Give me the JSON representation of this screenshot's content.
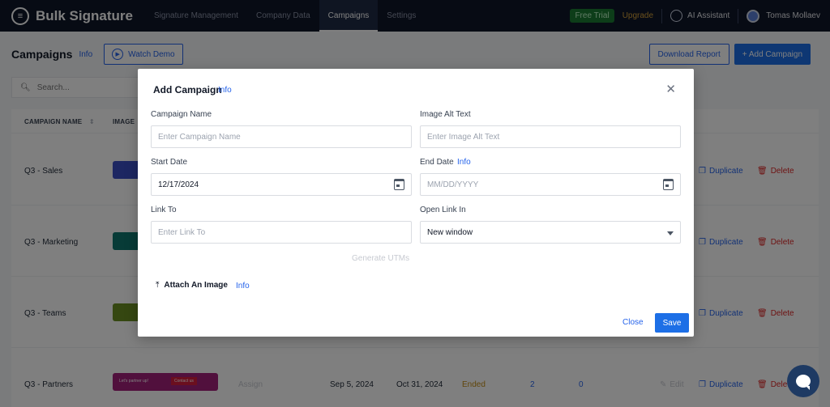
{
  "app": {
    "name": "Bulk Signature"
  },
  "nav": {
    "items": [
      {
        "label": "Signature Management"
      },
      {
        "label": "Company Data"
      },
      {
        "label": "Campaigns"
      },
      {
        "label": "Settings"
      }
    ],
    "active": "Campaigns",
    "free_trial": "Free Trial",
    "upgrade": "Upgrade",
    "ai_assistant": "AI Assistant",
    "user_name": "Tomas Mollaev"
  },
  "page": {
    "title": "Campaigns",
    "info": "Info",
    "watch_demo": "Watch Demo",
    "download_report": "Download Report",
    "add_campaign": "+ Add Campaign"
  },
  "search": {
    "placeholder": "Search..."
  },
  "table": {
    "headers": {
      "name": "CAMPAIGN NAME",
      "image": "IMAGE"
    },
    "rows": [
      {
        "name": "Q3 - Sales",
        "banner_color": "#3b4fc4",
        "duplicate": "Duplicate",
        "delete": "Delete"
      },
      {
        "name": "Q3 - Marketing",
        "banner_color": "#0f766e",
        "duplicate": "Duplicate",
        "delete": "Delete"
      },
      {
        "name": "Q3 - Teams",
        "banner_color": "#6b8e23",
        "duplicate": "Duplicate",
        "delete": "Delete"
      },
      {
        "name": "Q3 - Partners",
        "banner_color": "#a3207a",
        "banner_text": "Let's partner up!",
        "banner_btn": "Contact us",
        "assign": "Assign",
        "start": "Sep 5, 2024",
        "end": "Oct 31, 2024",
        "status": "Ended",
        "count1": "2",
        "count2": "0",
        "edit": "Edit",
        "duplicate": "Duplicate",
        "delete": "Delete"
      }
    ]
  },
  "modal": {
    "title": "Add Campaign",
    "info": "Info",
    "campaign_name": {
      "label": "Campaign Name",
      "placeholder": "Enter Campaign Name",
      "value": ""
    },
    "image_alt": {
      "label": "Image Alt Text",
      "placeholder": "Enter Image Alt Text",
      "value": ""
    },
    "start_date": {
      "label": "Start Date",
      "value": "12/17/2024"
    },
    "end_date": {
      "label": "End Date",
      "info": "Info",
      "placeholder": "MM/DD/YYYY",
      "value": ""
    },
    "link_to": {
      "label": "Link To",
      "placeholder": "Enter Link To",
      "value": ""
    },
    "open_link_in": {
      "label": "Open Link In",
      "value": "New window"
    },
    "generate_utms": "Generate UTMs",
    "attach_image": "Attach An Image",
    "attach_info": "Info",
    "close": "Close",
    "save": "Save"
  }
}
